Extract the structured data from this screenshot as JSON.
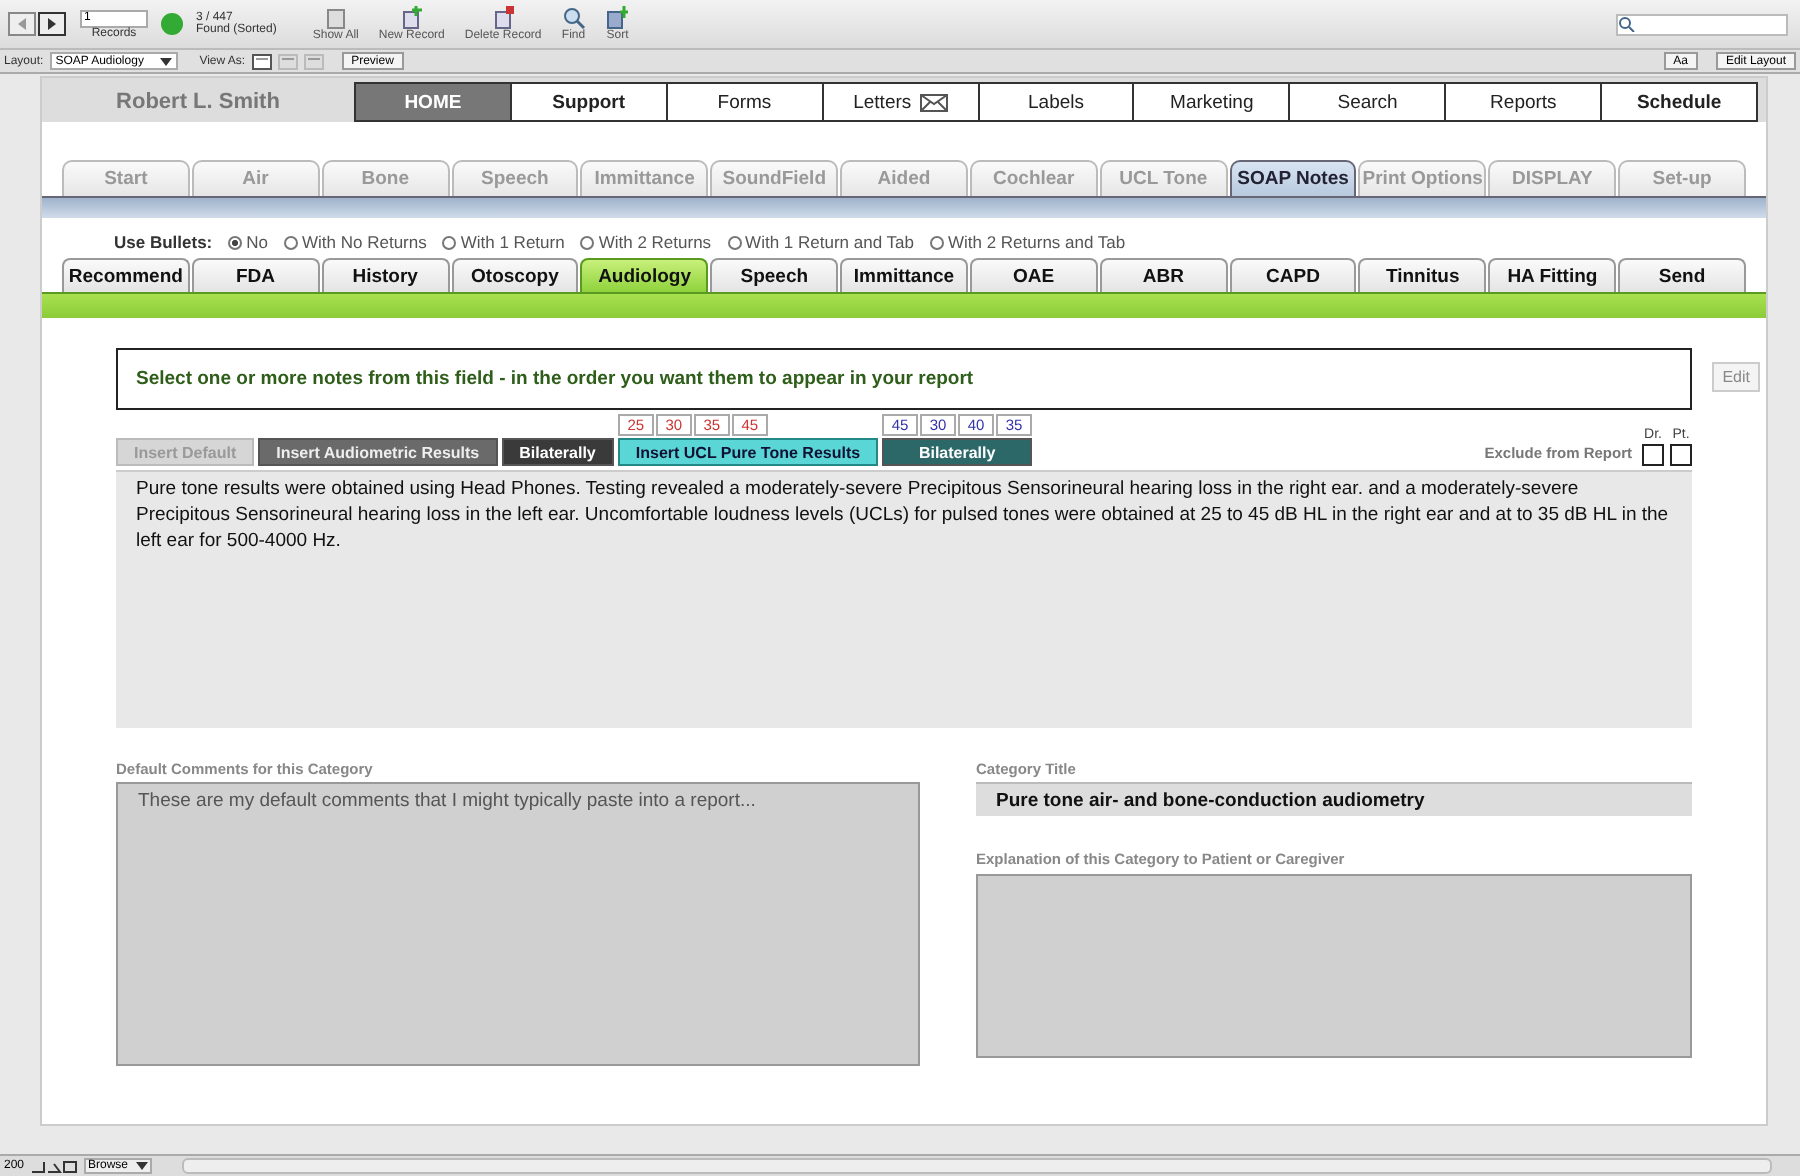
{
  "toolbar": {
    "record_number": "1",
    "records_label": "Records",
    "found_count": "3 / 447",
    "found_label": "Found (Sorted)",
    "buttons": [
      {
        "label": "Show All",
        "kind": "showall"
      },
      {
        "label": "New Record",
        "kind": "new"
      },
      {
        "label": "Delete Record",
        "kind": "delete"
      },
      {
        "label": "Find",
        "kind": "find"
      },
      {
        "label": "Sort",
        "kind": "sort"
      }
    ]
  },
  "layout_bar": {
    "layout_label": "Layout:",
    "layout_value": "SOAP Audiology",
    "view_as_label": "View As:",
    "view_modes": [
      {
        "selected": true
      },
      {
        "selected": false
      },
      {
        "selected": false
      }
    ],
    "preview": "Preview",
    "font_size": "Aa",
    "edit_layout": "Edit Layout"
  },
  "header": {
    "user_name": "Robert L. Smith",
    "nav": [
      {
        "label": "HOME",
        "selected": true,
        "kind": "plain"
      },
      {
        "label": "Support",
        "selected": false,
        "kind": "bold"
      },
      {
        "label": "Forms",
        "selected": false,
        "kind": "plain"
      },
      {
        "label": "Letters",
        "selected": false,
        "kind": "mail"
      },
      {
        "label": "Labels",
        "selected": false,
        "kind": "plain"
      },
      {
        "label": "Marketing",
        "selected": false,
        "kind": "plain"
      },
      {
        "label": "Search",
        "selected": false,
        "kind": "plain"
      },
      {
        "label": "Reports",
        "selected": false,
        "kind": "plain"
      },
      {
        "label": "Schedule",
        "selected": false,
        "kind": "bold"
      }
    ]
  },
  "test_tabs": [
    {
      "label": "Start",
      "selected": false
    },
    {
      "label": "Air",
      "selected": false
    },
    {
      "label": "Bone",
      "selected": false
    },
    {
      "label": "Speech",
      "selected": false
    },
    {
      "label": "Immittance",
      "selected": false
    },
    {
      "label": "SoundField",
      "selected": false
    },
    {
      "label": "Aided",
      "selected": false
    },
    {
      "label": "Cochlear",
      "selected": false
    },
    {
      "label": "UCL Tone",
      "selected": false
    },
    {
      "label": "SOAP Notes",
      "selected": true
    },
    {
      "label": "Print Options",
      "selected": false
    },
    {
      "label": "DISPLAY",
      "selected": false
    },
    {
      "label": "Set-up",
      "selected": false
    }
  ],
  "bullets": {
    "label": "Use Bullets:",
    "options": [
      {
        "label": "No",
        "selected": true
      },
      {
        "label": "With No Returns",
        "selected": false
      },
      {
        "label": "With 1 Return",
        "selected": false
      },
      {
        "label": "With 2 Returns",
        "selected": false
      },
      {
        "label": "With 1 Return and Tab",
        "selected": false
      },
      {
        "label": "With 2 Returns and Tab",
        "selected": false
      }
    ]
  },
  "category_tabs": [
    {
      "label": "Recommend",
      "selected": false
    },
    {
      "label": "FDA",
      "selected": false
    },
    {
      "label": "History",
      "selected": false
    },
    {
      "label": "Otoscopy",
      "selected": false
    },
    {
      "label": "Audiology",
      "selected": true
    },
    {
      "label": "Speech",
      "selected": false
    },
    {
      "label": "Immittance",
      "selected": false
    },
    {
      "label": "OAE",
      "selected": false
    },
    {
      "label": "ABR",
      "selected": false
    },
    {
      "label": "CAPD",
      "selected": false
    },
    {
      "label": "Tinnitus",
      "selected": false
    },
    {
      "label": "HA Fitting",
      "selected": false
    },
    {
      "label": "Send",
      "selected": false
    }
  ],
  "notes": {
    "instruction": "Select one or more notes from this field -  in the order you want them to appear in your report",
    "edit": "Edit",
    "ucl_values": [
      {
        "value": "25",
        "color": "#cc3333"
      },
      {
        "value": "30",
        "color": "#cc3333"
      },
      {
        "value": "35",
        "color": "#cc3333"
      },
      {
        "value": "45",
        "color": "#cc3333"
      },
      {
        "value": "45",
        "color": "#3333aa"
      },
      {
        "value": "30",
        "color": "#3333aa"
      },
      {
        "value": "40",
        "color": "#3333aa"
      },
      {
        "value": "35",
        "color": "#3333aa"
      }
    ],
    "buttons": [
      {
        "label": "Insert Default",
        "kind": "disabled"
      },
      {
        "label": "Insert Audiometric Results",
        "kind": "dark"
      },
      {
        "label": "Bilaterally",
        "kind": "darker"
      },
      {
        "label": "Insert UCL Pure Tone Results",
        "kind": "accent"
      },
      {
        "label": "Bilaterally",
        "kind": "teal"
      }
    ],
    "exclude_label": "Exclude from Report",
    "exclude": [
      {
        "label": "Dr.",
        "checked": false
      },
      {
        "label": "Pt.",
        "checked": false
      }
    ],
    "report_text": "Pure tone results were obtained using Head Phones. Testing revealed a moderately-severe Precipitous Sensorineural hearing loss in the right ear. and a moderately-severe Precipitous Sensorineural hearing loss in the left ear. Uncomfortable loudness levels (UCLs) for pulsed tones were obtained at 25 to 45 dB HL in the right ear and at  to 35 dB HL in the left ear for 500-4000 Hz."
  },
  "default_comments": {
    "label": "Default Comments for this Category",
    "placeholder": "These are my default comments that I might typically paste into a report..."
  },
  "category_title": {
    "label": "Category Title",
    "value": "Pure tone air- and bone-conduction audiometry"
  },
  "explanation": {
    "label": "Explanation of this Category to Patient or Caregiver"
  },
  "status_bar": {
    "zoom": "200",
    "mode": "Browse"
  }
}
